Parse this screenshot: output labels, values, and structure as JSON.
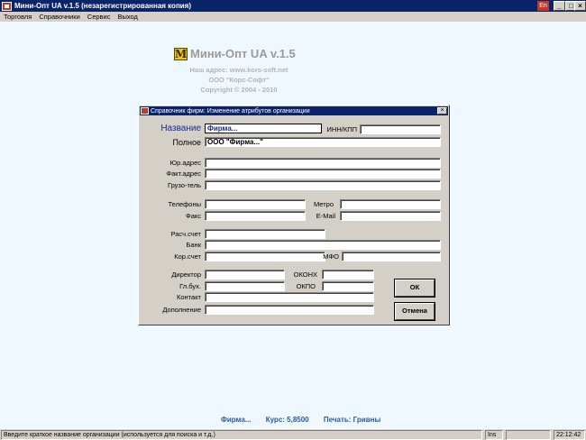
{
  "window": {
    "title": "Мини-Опт UA v.1.5 (незарегистрированная копия)",
    "language_indicator": "En",
    "minimize": "_",
    "maximize": "□",
    "close": "×"
  },
  "menu": [
    "Торговля",
    "Справочники",
    "Сервис",
    "Выход"
  ],
  "logo": {
    "letter": "M",
    "product": "Мини-Опт UA v.1.5",
    "address": "Наш адрес: www.kors-soft.net",
    "company": "ООО \"Корс-Софт\"",
    "copyright": "Copyright © 2004 - 2010"
  },
  "dialog": {
    "title": "Справочник фирм: Изменение атрибутов организации",
    "close": "×",
    "labels": {
      "name": "Название",
      "inn": "ИНН/КПП",
      "full": "Полное",
      "legal_address": "Юр.адрес",
      "actual_address": "Факт.адрес",
      "consignee": "Грузо-тель",
      "phones": "Телефоны",
      "metro": "Метро",
      "fax": "Факс",
      "email": "E-Mail",
      "account": "Расч.счет",
      "bank": "Банк",
      "corr_account": "Кор.счет",
      "mfo": "МФО",
      "director": "Директор",
      "okonh": "ОКОНХ",
      "chief_accountant": "Гл.бух.",
      "okpo": "ОКПО",
      "contact": "Контакт",
      "addition": "Дополнение"
    },
    "values": {
      "name": "Фирма...",
      "inn": "",
      "full": "ООО \"Фирма...\"",
      "legal_address": "",
      "actual_address": "",
      "consignee": "",
      "phones": "",
      "metro": "",
      "fax": "",
      "email": "",
      "account": "",
      "bank": "",
      "corr_account": "",
      "mfo": "",
      "director": "",
      "okonh": "",
      "chief_accountant": "",
      "okpo": "",
      "contact": "",
      "addition": ""
    },
    "ok_label": "ОК",
    "cancel_label": "Отмена"
  },
  "bottom": {
    "firm": "Фирма...",
    "rate": "Курс: 5,8500",
    "print": "Печать: Гривны"
  },
  "statusbar": {
    "hint": "Введите краткое название организации (используется для поиска и т.д.)",
    "mode": "Ins",
    "time": "22:12:42"
  },
  "colors": {
    "titlebar": "#0a246a",
    "desktop": "#f0f8ff",
    "name_label": "#1a2a9a",
    "bottom_info": "#2a5aa0"
  }
}
